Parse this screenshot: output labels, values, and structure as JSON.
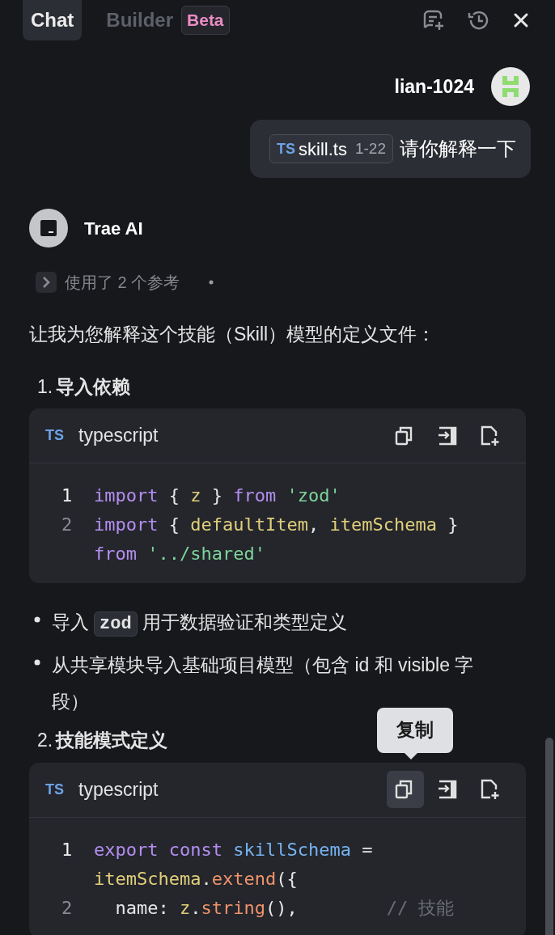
{
  "tabs": [
    {
      "label": "Chat",
      "selected": true
    },
    {
      "label": "Builder",
      "selected": false,
      "badge": "Beta"
    }
  ],
  "user": {
    "name": "lian-1024",
    "file_chip": {
      "lang": "TS",
      "file": "skill.ts",
      "range": "1-22"
    },
    "message": "请你解释一下"
  },
  "assistant": {
    "name": "Trae AI",
    "references": {
      "label": "使用了 2 个参考",
      "expanded": false
    },
    "content": [
      {
        "kind": "paragraph",
        "text": "让我为您解释这个技能（Skill）模型的定义文件："
      },
      {
        "kind": "heading",
        "number": "1.",
        "text": "导入依赖"
      },
      {
        "kind": "code",
        "lang_icon": "TS",
        "lang": "typescript",
        "copy_hovered": false,
        "lines": [
          {
            "number": "1",
            "current": true,
            "tokens": [
              {
                "kind": "keyword",
                "text": "import"
              },
              {
                "kind": "plain",
                "text": " { "
              },
              {
                "kind": "ident",
                "text": "z"
              },
              {
                "kind": "plain",
                "text": " } "
              },
              {
                "kind": "keyword",
                "text": "from "
              },
              {
                "kind": "string",
                "text": "'zod'"
              }
            ]
          },
          {
            "number": "2",
            "current": false,
            "tokens": [
              {
                "kind": "keyword",
                "text": "import"
              },
              {
                "kind": "plain",
                "text": " { "
              },
              {
                "kind": "ident",
                "text": "defaultItem"
              },
              {
                "kind": "plain",
                "text": ", "
              },
              {
                "kind": "ident",
                "text": "itemSchema"
              },
              {
                "kind": "plain",
                "text": " } "
              },
              {
                "kind": "keyword",
                "text": "from "
              },
              {
                "kind": "string",
                "text": "'../shared'"
              }
            ]
          }
        ]
      },
      {
        "kind": "bullets",
        "items": [
          {
            "parts": [
              {
                "kind": "text",
                "text": "导入"
              },
              {
                "kind": "code",
                "text": "zod"
              },
              {
                "kind": "text",
                "text": "用于数据验证和类型定义"
              }
            ]
          },
          {
            "parts": [
              {
                "kind": "text",
                "text": "从共享模块导入基础项目模型（包含 id 和 visible 字段）"
              }
            ]
          }
        ]
      },
      {
        "kind": "heading",
        "number": "2.",
        "text": "技能模式定义"
      },
      {
        "kind": "code",
        "lang_icon": "TS",
        "lang": "typescript",
        "copy_hovered": true,
        "tooltip": "复制",
        "lines": [
          {
            "number": "1",
            "current": true,
            "tokens": [
              {
                "kind": "keyword",
                "text": "export const "
              },
              {
                "kind": "variable",
                "text": "skillSchema"
              },
              {
                "kind": "plain",
                "text": " = "
              },
              {
                "kind": "ident",
                "text": "itemSchema"
              },
              {
                "kind": "plain",
                "text": "."
              },
              {
                "kind": "func",
                "text": "extend"
              },
              {
                "kind": "plain",
                "text": "({"
              }
            ]
          },
          {
            "number": "2",
            "current": false,
            "tokens": [
              {
                "kind": "plain",
                "text": "  name: "
              },
              {
                "kind": "ident",
                "text": "z"
              },
              {
                "kind": "plain",
                "text": "."
              },
              {
                "kind": "func",
                "text": "string"
              },
              {
                "kind": "plain",
                "text": "(),"
              },
              {
                "kind": "comment",
                "text": "// 技能"
              }
            ]
          }
        ]
      }
    ]
  }
}
